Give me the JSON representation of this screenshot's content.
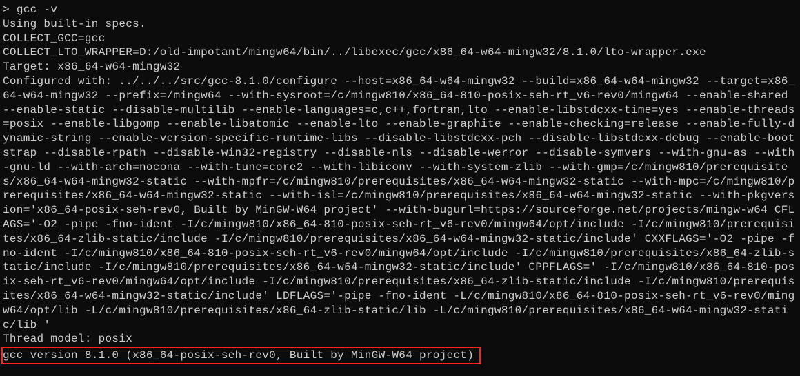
{
  "terminal": {
    "prompt": ">",
    "command": "gcc -v",
    "lines": {
      "line1": "Using built-in specs.",
      "line2": "COLLECT_GCC=gcc",
      "line3": "COLLECT_LTO_WRAPPER=D:/old-impotant/mingw64/bin/../libexec/gcc/x86_64-w64-mingw32/8.1.0/lto-wrapper.exe",
      "line4": "Target: x86_64-w64-mingw32",
      "configured": "Configured with: ../../../src/gcc-8.1.0/configure --host=x86_64-w64-mingw32 --build=x86_64-w64-mingw32 --target=x86_64-w64-mingw32 --prefix=/mingw64 --with-sysroot=/c/mingw810/x86_64-810-posix-seh-rt_v6-rev0/mingw64 --enable-shared --enable-static --disable-multilib --enable-languages=c,c++,fortran,lto --enable-libstdcxx-time=yes --enable-threads=posix --enable-libgomp --enable-libatomic --enable-lto --enable-graphite --enable-checking=release --enable-fully-dynamic-string --enable-version-specific-runtime-libs --disable-libstdcxx-pch --disable-libstdcxx-debug --enable-bootstrap --disable-rpath --disable-win32-registry --disable-nls --disable-werror --disable-symvers --with-gnu-as --with-gnu-ld --with-arch=nocona --with-tune=core2 --with-libiconv --with-system-zlib --with-gmp=/c/mingw810/prerequisites/x86_64-w64-mingw32-static --with-mpfr=/c/mingw810/prerequisites/x86_64-w64-mingw32-static --with-mpc=/c/mingw810/prerequisites/x86_64-w64-mingw32-static --with-isl=/c/mingw810/prerequisites/x86_64-w64-mingw32-static --with-pkgversion='x86_64-posix-seh-rev0, Built by MinGW-W64 project' --with-bugurl=https://sourceforge.net/projects/mingw-w64 CFLAGS='-O2 -pipe -fno-ident -I/c/mingw810/x86_64-810-posix-seh-rt_v6-rev0/mingw64/opt/include -I/c/mingw810/prerequisites/x86_64-zlib-static/include -I/c/mingw810/prerequisites/x86_64-w64-mingw32-static/include' CXXFLAGS='-O2 -pipe -fno-ident -I/c/mingw810/x86_64-810-posix-seh-rt_v6-rev0/mingw64/opt/include -I/c/mingw810/prerequisites/x86_64-zlib-static/include -I/c/mingw810/prerequisites/x86_64-w64-mingw32-static/include' CPPFLAGS=' -I/c/mingw810/x86_64-810-posix-seh-rt_v6-rev0/mingw64/opt/include -I/c/mingw810/prerequisites/x86_64-zlib-static/include -I/c/mingw810/prerequisites/x86_64-w64-mingw32-static/include' LDFLAGS='-pipe -fno-ident -L/c/mingw810/x86_64-810-posix-seh-rt_v6-rev0/mingw64/opt/lib -L/c/mingw810/prerequisites/x86_64-zlib-static/lib -L/c/mingw810/prerequisites/x86_64-w64-mingw32-static/lib '",
      "thread_model": "Thread model: posix",
      "version": "gcc version 8.1.0 (x86_64-posix-seh-rev0, Built by MinGW-W64 project)"
    }
  }
}
